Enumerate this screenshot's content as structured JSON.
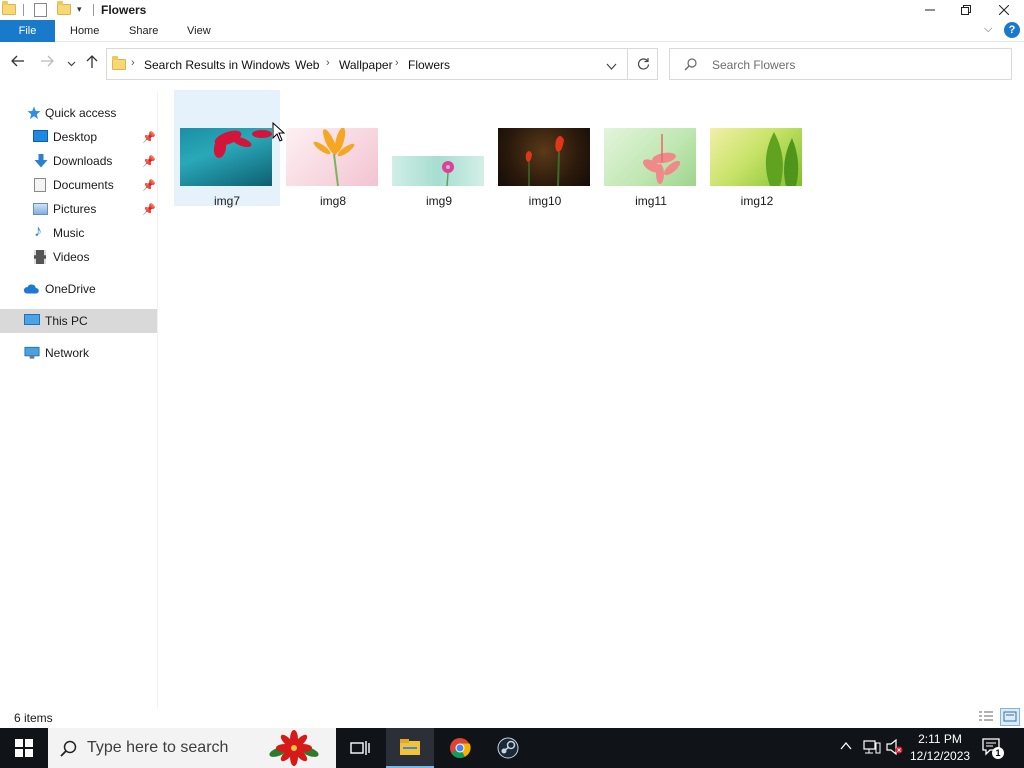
{
  "window": {
    "title": "Flowers"
  },
  "ribbon": {
    "tabs": [
      {
        "label": "File"
      },
      {
        "label": "Home"
      },
      {
        "label": "Share"
      },
      {
        "label": "View"
      }
    ],
    "help": "?"
  },
  "address": {
    "crumbs": [
      "Search Results in Windows",
      "Web",
      "Wallpaper",
      "Flowers"
    ]
  },
  "search": {
    "placeholder": "Search Flowers"
  },
  "sidebar": {
    "items": [
      {
        "label": "Quick access",
        "icon": "star-icon"
      },
      {
        "label": "Desktop",
        "icon": "desktop-icon",
        "pinned": true
      },
      {
        "label": "Downloads",
        "icon": "download-arrow-icon",
        "pinned": true
      },
      {
        "label": "Documents",
        "icon": "documents-icon",
        "pinned": true
      },
      {
        "label": "Pictures",
        "icon": "pictures-icon",
        "pinned": true
      },
      {
        "label": "Music",
        "icon": "music-note-icon"
      },
      {
        "label": "Videos",
        "icon": "film-icon"
      },
      {
        "label": "OneDrive",
        "icon": "cloud-icon"
      },
      {
        "label": "This PC",
        "icon": "computer-icon",
        "selected": true
      },
      {
        "label": "Network",
        "icon": "network-icon"
      }
    ]
  },
  "files": [
    {
      "name": "img7",
      "selected": true
    },
    {
      "name": "img8"
    },
    {
      "name": "img9"
    },
    {
      "name": "img10"
    },
    {
      "name": "img11"
    },
    {
      "name": "img12"
    }
  ],
  "status": {
    "item_count": "6 items"
  },
  "taskbar": {
    "search_placeholder": "Type here to search",
    "time": "2:11 PM",
    "date": "12/12/2023",
    "notification_count": "1"
  },
  "colors": {
    "accent": "#1979ca",
    "selection": "#e5f1fb",
    "taskbar": "#101418"
  }
}
